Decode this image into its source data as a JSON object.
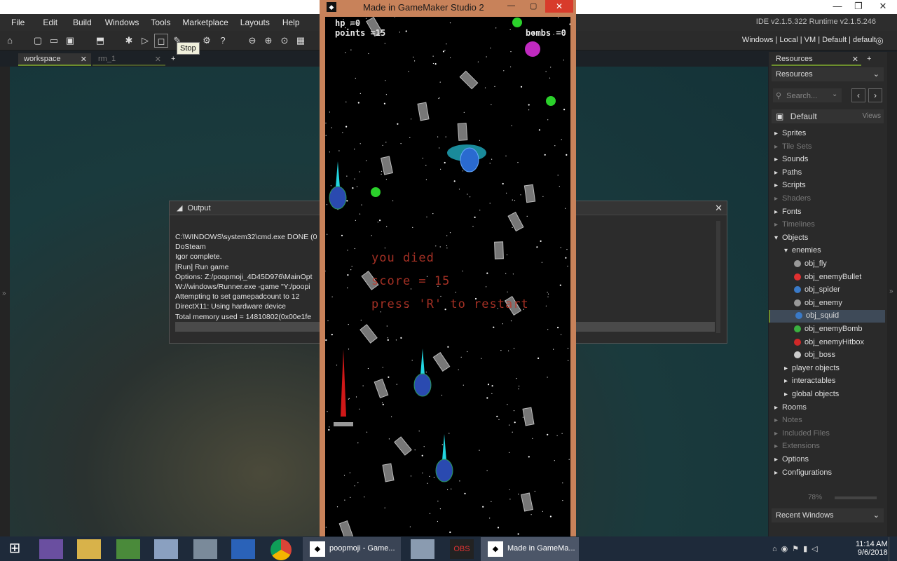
{
  "ide": {
    "menu": [
      "File",
      "Edit",
      "Build",
      "Windows",
      "Tools",
      "Marketplace",
      "Layouts",
      "Help"
    ],
    "version": "IDE v2.1.5.322 Runtime v2.1.5.246",
    "targets": "Windows  |  Local  |  VM  |  Default  |  default",
    "tooltip": "Stop",
    "tabs": [
      {
        "label": "workspace"
      },
      {
        "label": "rm_1"
      }
    ],
    "add_tab": "+"
  },
  "output": {
    "title": "Output",
    "lines": [
      "C:\\WINDOWS\\system32\\cmd.exe DONE (0",
      "DoSteam",
      "Igor complete.",
      "[Run] Run game",
      "Options: Z:/poopmoji_4D45D976\\MainOpt",
      "W://windows/Runner.exe  -game \"Y:/poopi",
      "Attempting to set gamepadcount to 12",
      "DirectX11: Using hardware device",
      "Total memory used = 14810802(0x00e1fe"
    ]
  },
  "game": {
    "title": "Made in GameMaker Studio 2",
    "hp": "hp =0",
    "points": "points =15",
    "bombs": "bombs =0",
    "died": "you died",
    "score": "score = 15",
    "restart": "press 'R' to restart"
  },
  "resources": {
    "tab": "Resources",
    "dropdown": "Resources",
    "search_placeholder": "Search...",
    "group": "Default",
    "views": "Views",
    "zoom": "78%",
    "recent": "Recent Windows",
    "items": [
      {
        "label": "Sprites",
        "indent": 0,
        "arrow": "▸",
        "dim": false
      },
      {
        "label": "Tile Sets",
        "indent": 0,
        "arrow": "▸",
        "dim": true
      },
      {
        "label": "Sounds",
        "indent": 0,
        "arrow": "▸",
        "dim": false
      },
      {
        "label": "Paths",
        "indent": 0,
        "arrow": "▸",
        "dim": false
      },
      {
        "label": "Scripts",
        "indent": 0,
        "arrow": "▸",
        "dim": false
      },
      {
        "label": "Shaders",
        "indent": 0,
        "arrow": "▸",
        "dim": true
      },
      {
        "label": "Fonts",
        "indent": 0,
        "arrow": "▸",
        "dim": false
      },
      {
        "label": "Timelines",
        "indent": 0,
        "arrow": "▸",
        "dim": true
      },
      {
        "label": "Objects",
        "indent": 0,
        "arrow": "▾",
        "dim": false
      },
      {
        "label": "enemies",
        "indent": 1,
        "arrow": "▾",
        "dim": false
      },
      {
        "label": "obj_fly",
        "indent": 2,
        "arrow": "",
        "dim": false
      },
      {
        "label": "obj_enemyBullet",
        "indent": 2,
        "arrow": "",
        "dim": false
      },
      {
        "label": "obj_spider",
        "indent": 2,
        "arrow": "",
        "dim": false
      },
      {
        "label": "obj_enemy",
        "indent": 2,
        "arrow": "",
        "dim": false
      },
      {
        "label": "obj_squid",
        "indent": 2,
        "arrow": "",
        "dim": false,
        "selected": true
      },
      {
        "label": "obj_enemyBomb",
        "indent": 2,
        "arrow": "",
        "dim": false
      },
      {
        "label": "obj_enemyHitbox",
        "indent": 2,
        "arrow": "",
        "dim": false
      },
      {
        "label": "obj_boss",
        "indent": 2,
        "arrow": "",
        "dim": false
      },
      {
        "label": "player objects",
        "indent": 1,
        "arrow": "▸",
        "dim": false
      },
      {
        "label": "interactables",
        "indent": 1,
        "arrow": "▸",
        "dim": false
      },
      {
        "label": "global objects",
        "indent": 1,
        "arrow": "▸",
        "dim": false
      },
      {
        "label": "Rooms",
        "indent": 0,
        "arrow": "▸",
        "dim": false
      },
      {
        "label": "Notes",
        "indent": 0,
        "arrow": "▸",
        "dim": true
      },
      {
        "label": "Included Files",
        "indent": 0,
        "arrow": "▸",
        "dim": true
      },
      {
        "label": "Extensions",
        "indent": 0,
        "arrow": "▸",
        "dim": true
      },
      {
        "label": "Options",
        "indent": 0,
        "arrow": "▸",
        "dim": false
      },
      {
        "label": "Configurations",
        "indent": 0,
        "arrow": "▸",
        "dim": false
      }
    ]
  },
  "taskbar": {
    "apps": [
      "poopmoji - Game...",
      "Made in GameMa..."
    ],
    "obs": "OBS",
    "time": "11:14 AM",
    "date": "9/6/2018"
  }
}
